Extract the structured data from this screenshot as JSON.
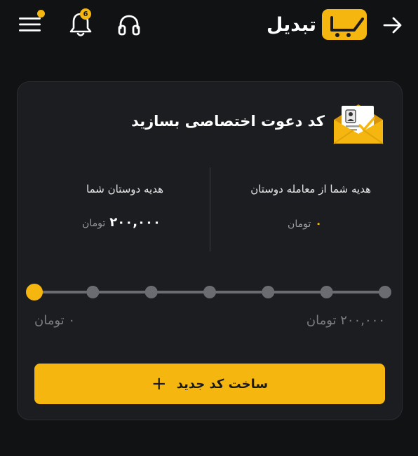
{
  "header": {
    "brand_name": "تبدیل",
    "notification_count": "6",
    "icons": {
      "menu": "hamburger-menu-icon",
      "notifications": "bell-icon",
      "support": "headset-icon",
      "back": "arrow-right-icon",
      "logo": "brand-logo-icon"
    }
  },
  "card": {
    "title": "کد دعوت اختصاصی بسازید",
    "icon": "envelope-invite-icon",
    "stats": {
      "your_gift_label": "هدیه شما از معامله دوستان",
      "your_gift_value": "۰",
      "your_gift_unit": "تومان",
      "friends_gift_label": "هدیه دوستان شما",
      "friends_gift_value": "۲۰۰,۰۰۰",
      "friends_gift_unit": "تومان"
    },
    "progress": {
      "steps": 7,
      "active_step": 1,
      "min_label": "۰ تومان",
      "max_label": "۲۰۰,۰۰۰ تومان"
    },
    "create_button_label": "ساخت کد جدید"
  },
  "colors": {
    "accent": "#f5b70f",
    "background": "#111214",
    "card": "#1c1d20",
    "muted": "#7d7e83"
  }
}
